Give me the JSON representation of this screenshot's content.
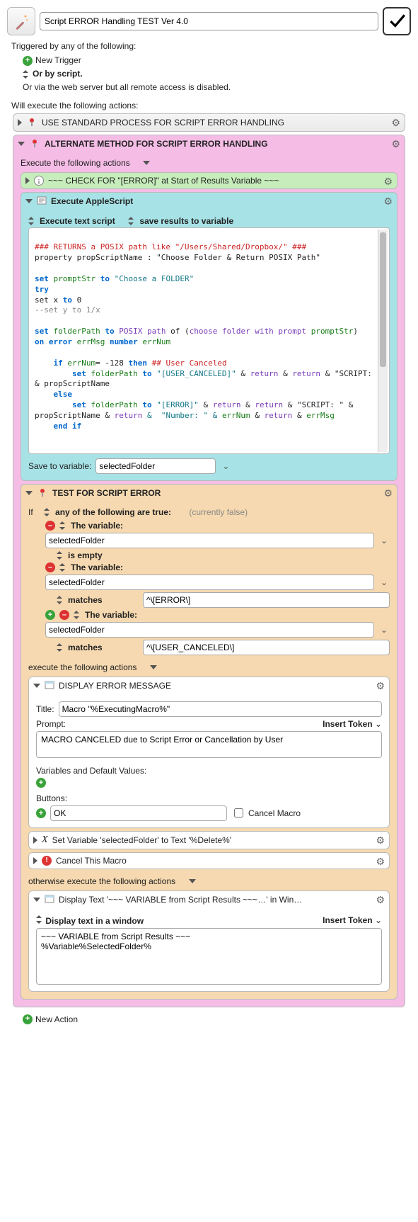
{
  "header": {
    "title": "Script ERROR Handling TEST Ver 4.0"
  },
  "triggers": {
    "heading": "Triggered by any of the following:",
    "new_trigger": "New Trigger",
    "or_script": "Or by script.",
    "or_web": "Or via the web server but all remote access is disabled."
  },
  "will_exec": "Will execute the following actions:",
  "grp_standard": {
    "title": "USE STANDARD PROCESS FOR SCRIPT ERROR HANDLING"
  },
  "grp_alternate": {
    "title": "ALTERNATE METHOD FOR SCRIPT ERROR HANDLING",
    "sub_exec": "Execute the following actions",
    "check_err": {
      "title": "~~~ CHECK FOR \"[ERROR]\" at Start of Results Variable ~~~"
    },
    "applescript": {
      "title": "Execute AppleScript",
      "opt1": "Execute text script",
      "opt2": "save results to variable",
      "save_label": "Save to variable:",
      "save_var": "selectedFolder"
    },
    "script_text": {
      "l1": "### RETURNS a POSIX path like \"/Users/Shared/Dropbox/\" ###",
      "l2": "property propScriptName : \"Choose Folder & Return POSIX Path\"",
      "l3a": "set",
      "l3b": "promptStr",
      "l3c": "to",
      "l3d": "\"Choose a FOLDER\"",
      "l4": "try",
      "l5a": "set x",
      "l5b": "to",
      "l5c": "0",
      "l6": "--set y to 1/x",
      "l7a": "set",
      "l7b": "folderPath",
      "l7c": "to",
      "l7d": "POSIX path",
      "l7e": "of (",
      "l7f": "choose folder with prompt",
      "l7g": "promptStr",
      "l7h": ")",
      "l8a": "on error",
      "l8b": "errMsg",
      "l8c": "number",
      "l8d": "errNum",
      "l9a": "    if",
      "l9b": "errNum",
      "l9c": "= -128",
      "l9d": "then",
      "l9e": "## User Canceled",
      "l10a": "        set",
      "l10b": "folderPath",
      "l10c": "to",
      "l10d": "\"[USER_CANCELED]\"",
      "l10e": "&",
      "l10f": "return",
      "l10g": "&",
      "l10h": "return",
      "l10i": "& \"SCRIPT: \" & propScriptName",
      "l11": "    else",
      "l12a": "        set",
      "l12b": "folderPath",
      "l12c": "to",
      "l12d": "\"[ERROR]\"",
      "l12e": "&",
      "l12f": "return",
      "l12g": "&",
      "l12h": "return",
      "l12i": "&",
      "l12j": "\"SCRIPT: \" & propScriptName &",
      "l12k": "return",
      "l12l": "&  \"Number: \" &",
      "l12m": "errNum",
      "l12n": "&",
      "l12o": "return",
      "l12p": "&",
      "l12q": "errMsg",
      "l13": "    end if"
    },
    "test": {
      "title": "TEST FOR SCRIPT ERROR",
      "if_label": "If",
      "any_label": "any of the following are true:",
      "currently": "(currently false)",
      "the_variable": "The variable:",
      "var_name": "selectedFolder",
      "is_empty": "is empty",
      "matches": "matches",
      "regex1": "^\\[ERROR\\]",
      "regex2": "^\\[USER_CANCELED\\]",
      "exec_following": "execute the following actions",
      "display_err": {
        "title": "DISPLAY ERROR MESSAGE",
        "title_lbl": "Title:",
        "title_val": "Macro \"%ExecutingMacro%\"",
        "prompt_lbl": "Prompt:",
        "insert_token": "Insert Token",
        "prompt_val": "MACRO CANCELED due to Script Error or Cancellation by User",
        "vars_lbl": "Variables and Default Values:",
        "buttons_lbl": "Buttons:",
        "ok_val": "OK",
        "cancel_macro": "Cancel Macro"
      },
      "set_var": "Set Variable 'selectedFolder' to Text '%Delete%'",
      "cancel_macro_action": "Cancel This Macro",
      "otherwise": "otherwise execute the following actions",
      "display_text": {
        "title": "Display Text '~~~ VARIABLE from Script Results ~~~…' in Win…",
        "opt": "Display text in a window",
        "insert_token": "Insert Token",
        "body": "~~~ VARIABLE from Script Results ~~~\n%Variable%SelectedFolder%"
      }
    }
  },
  "new_action": "New Action"
}
